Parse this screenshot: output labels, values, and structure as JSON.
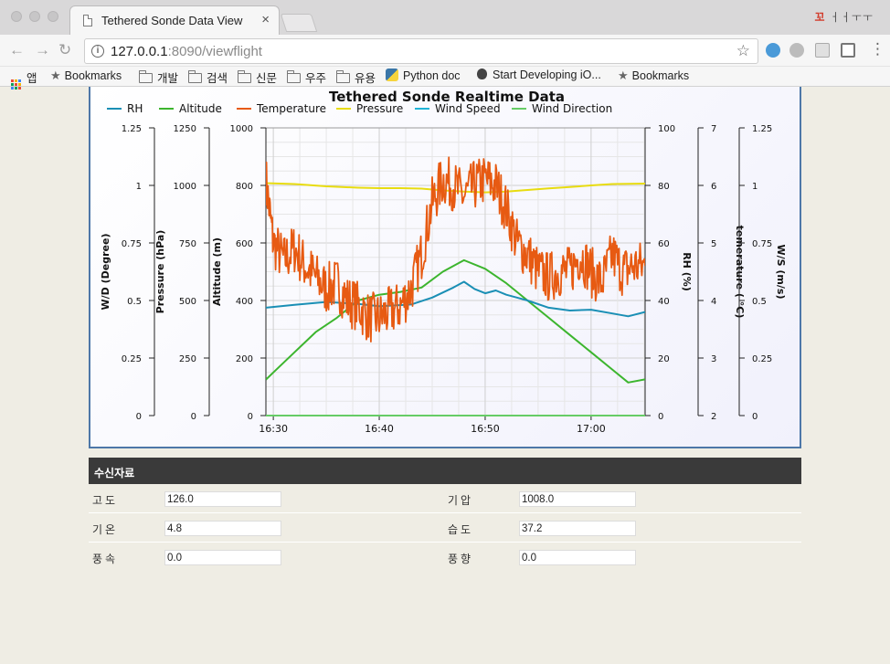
{
  "browser": {
    "tab_title": "Tethered Sonde Data View",
    "tab_close": "×",
    "url_host": "127.0.0.1",
    "url_rest": ":8090/viewflight",
    "info_glyph": "i",
    "star_glyph": "☆",
    "back_glyph": "←",
    "forward_glyph": "→",
    "reload_glyph": "↻",
    "ext_top_text": "꼬",
    "ext_top_marks": "ㅓㅓㅜㅜ"
  },
  "bookmarks": [
    {
      "label": "앱",
      "icon": "apps-icon"
    },
    {
      "label": "Bookmarks",
      "icon": "star-icon"
    },
    {
      "label": "개발",
      "icon": "folder-icon"
    },
    {
      "label": "검색",
      "icon": "folder-icon"
    },
    {
      "label": "신문",
      "icon": "folder-icon"
    },
    {
      "label": "우주",
      "icon": "folder-icon"
    },
    {
      "label": "유용",
      "icon": "folder-icon"
    },
    {
      "label": "Python doc",
      "icon": "python-icon"
    },
    {
      "label": "Start Developing iO...",
      "icon": "apple-icon"
    },
    {
      "label": "Bookmarks",
      "icon": "star-icon"
    }
  ],
  "chart_data": {
    "type": "line",
    "title": "Tethered Sonde Realtime Data",
    "legend_position": "top-left",
    "grid": true,
    "x_axis": {
      "type": "time",
      "ticks": [
        "16:30",
        "16:40",
        "16:50",
        "17:00"
      ],
      "tick_minutes": [
        990,
        1000,
        1010,
        1020
      ],
      "range_minutes": [
        989.3,
        1025.1
      ]
    },
    "y_axes": [
      {
        "label": "W/D (Degree)",
        "side": "left",
        "range": [
          0,
          1.25
        ],
        "ticks": [
          "0",
          "0.25",
          "0.5",
          "0.75",
          "1",
          "1.25"
        ]
      },
      {
        "label": "Pressure (hPa)",
        "side": "left",
        "range": [
          0,
          1250
        ],
        "ticks": [
          "0",
          "250",
          "500",
          "750",
          "1000",
          "1250"
        ]
      },
      {
        "label": "Altitude (m)",
        "side": "left",
        "range": [
          0,
          1000
        ],
        "ticks": [
          "0",
          "200",
          "400",
          "600",
          "800",
          "1000"
        ]
      },
      {
        "label": "RH (%)",
        "side": "right",
        "range": [
          0,
          100
        ],
        "ticks": [
          "0",
          "20",
          "40",
          "60",
          "80",
          "100"
        ]
      },
      {
        "label": "temerature ( °C)",
        "side": "right",
        "range": [
          2,
          7
        ],
        "ticks": [
          "2",
          "3",
          "4",
          "5",
          "6",
          "7"
        ]
      },
      {
        "label": "W/S (m/s)",
        "side": "right",
        "range": [
          0,
          1.25
        ],
        "ticks": [
          "0",
          "0.25",
          "0.5",
          "0.75",
          "1",
          "1.25"
        ]
      }
    ],
    "series": [
      {
        "name": "RH",
        "color": "#1a8fb5",
        "axis": 3,
        "x": [
          989.3,
          992,
          995,
          998,
          1000,
          1001.5,
          1003,
          1005,
          1007,
          1008,
          1009,
          1010,
          1011,
          1012,
          1013,
          1014,
          1016,
          1018,
          1020,
          1022,
          1023.5,
          1025.1
        ],
        "y": [
          37.5,
          38.5,
          39.5,
          38.8,
          38.0,
          38.3,
          38.6,
          41.0,
          44.5,
          46.5,
          44.0,
          42.5,
          43.5,
          42.0,
          41.0,
          40.0,
          37.5,
          36.5,
          36.8,
          35.5,
          34.5,
          36.0
        ]
      },
      {
        "name": "Altitude",
        "color": "#3cb52e",
        "axis": 2,
        "x": [
          989.3,
          990,
          992,
          994,
          996,
          998,
          1000,
          1002,
          1004,
          1006,
          1008,
          1010,
          1012,
          1014,
          1016,
          1018,
          1020,
          1022,
          1023.5,
          1025.1
        ],
        "y": [
          125,
          150,
          220,
          290,
          340,
          400,
          420,
          430,
          445,
          500,
          540,
          510,
          460,
          400,
          340,
          280,
          220,
          160,
          115,
          126
        ]
      },
      {
        "name": "Temperature",
        "color": "#e75a12",
        "axis": 4,
        "noisy": true,
        "x": [
          989.3,
          990,
          991,
          992,
          993,
          994,
          995,
          996,
          997,
          998,
          999,
          1000,
          1001,
          1002,
          1003,
          1004,
          1005,
          1006,
          1007,
          1008,
          1009,
          1010,
          1011,
          1012,
          1013,
          1014,
          1015,
          1016,
          1017,
          1018,
          1019,
          1020,
          1021,
          1022,
          1023,
          1024,
          1025.1
        ],
        "y": [
          6.1,
          5.0,
          4.7,
          4.9,
          4.6,
          4.4,
          4.2,
          4.3,
          4.0,
          3.9,
          3.7,
          3.7,
          3.8,
          3.9,
          4.2,
          4.8,
          5.7,
          6.1,
          6.0,
          5.8,
          6.0,
          6.1,
          6.0,
          5.6,
          5.0,
          4.8,
          4.5,
          4.4,
          4.5,
          4.5,
          4.8,
          4.5,
          4.3,
          4.8,
          4.5,
          4.6,
          4.6
        ]
      },
      {
        "name": "Pressure",
        "color": "#e8dc10",
        "axis": 1,
        "x": [
          989.3,
          992,
          995,
          998,
          1000,
          1002,
          1004,
          1006,
          1008,
          1010,
          1012,
          1014,
          1016,
          1018,
          1020,
          1022,
          1025.1
        ],
        "y": [
          1010,
          1006,
          996,
          990,
          988,
          988,
          986,
          978,
          973,
          970,
          973,
          980,
          987,
          993,
          1000,
          1006,
          1008
        ]
      },
      {
        "name": "Wind Speed",
        "color": "#1fb3d6",
        "axis": 5,
        "x": [
          989.3,
          1025.1
        ],
        "y": [
          0,
          0
        ]
      },
      {
        "name": "Wind Direction",
        "color": "#66cc66",
        "axis": 0,
        "x": [
          989.3,
          1025.1
        ],
        "y": [
          0,
          0
        ]
      }
    ]
  },
  "received": {
    "heading": "수신자료",
    "rows": [
      {
        "l1": "고도",
        "v1": "126.0",
        "l2": "기압",
        "v2": "1008.0"
      },
      {
        "l1": "기온",
        "v1": "4.8",
        "l2": "습도",
        "v2": "37.2"
      },
      {
        "l1": "풍속",
        "v1": "0.0",
        "l2": "풍향",
        "v2": "0.0"
      }
    ]
  }
}
